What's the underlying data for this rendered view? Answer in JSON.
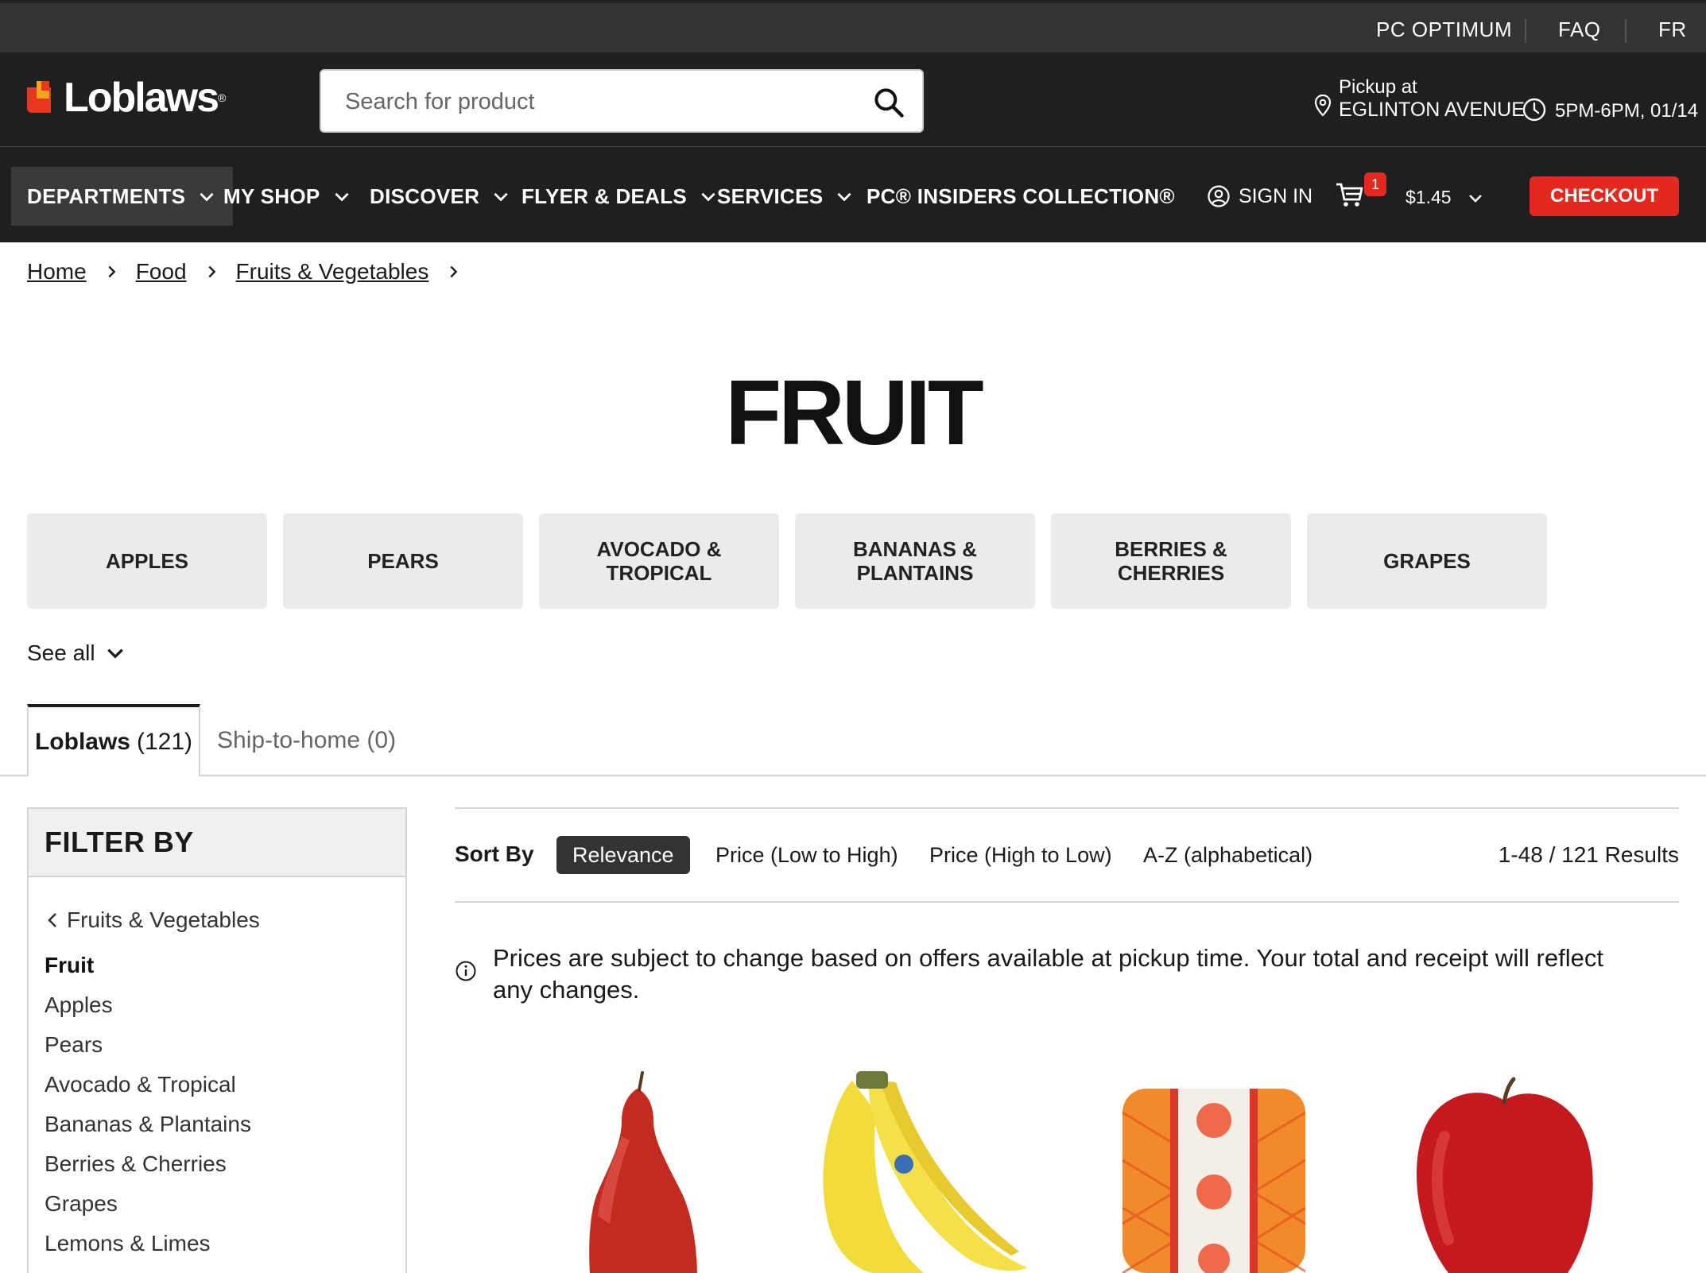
{
  "utility": {
    "pc_optimum": "PC OPTIMUM",
    "faq": "FAQ",
    "lang": "FR"
  },
  "header": {
    "logo_text": "Loblaws",
    "logo_reg": "®",
    "search_placeholder": "Search for product",
    "pickup_label": "Pickup at",
    "pickup_location": "EGLINTON AVENUE",
    "timeslot": "5PM-6PM, 01/14"
  },
  "nav": {
    "items": [
      {
        "label": "DEPARTMENTS"
      },
      {
        "label": "MY SHOP"
      },
      {
        "label": "DISCOVER"
      },
      {
        "label": "FLYER & DEALS"
      },
      {
        "label": "SERVICES"
      },
      {
        "label": "PC® INSIDERS COLLECTION®"
      }
    ],
    "sign_in": "SIGN IN",
    "cart_count": "1",
    "cart_total": "$1.45",
    "checkout": "CHECKOUT"
  },
  "breadcrumb": [
    "Home",
    "Food",
    "Fruits & Vegetables"
  ],
  "page_title": "FRUIT",
  "tiles": [
    "APPLES",
    "PEARS",
    "AVOCADO & TROPICAL",
    "BANANAS & PLANTAINS",
    "BERRIES & CHERRIES",
    "GRAPES"
  ],
  "see_all": "See all",
  "tabs": {
    "loblaws_label": "Loblaws",
    "loblaws_count": "(121)",
    "ship_label": "Ship-to-home (0)"
  },
  "filter": {
    "title": "FILTER BY",
    "back": "Fruits & Vegetables",
    "current": "Fruit",
    "items": [
      "Apples",
      "Pears",
      "Avocado & Tropical",
      "Bananas & Plantains",
      "Berries & Cherries",
      "Grapes",
      "Lemons & Limes"
    ]
  },
  "sort": {
    "label": "Sort By",
    "options": [
      "Relevance",
      "Price (Low to High)",
      "Price (High to Low)",
      "A-Z (alphabetical)"
    ],
    "results": "1-48 / 121 Results"
  },
  "notice": "Prices are subject to change based on offers available at pickup time. Your total and receipt will reflect any changes.",
  "products": [
    {
      "icon": "pear-image"
    },
    {
      "icon": "banana-image"
    },
    {
      "icon": "grapefruit-bag-image"
    },
    {
      "icon": "apple-image"
    }
  ],
  "colors": {
    "accent_red": "#e3281d",
    "header_bg": "#1f1f1f",
    "utility_bg": "#333333"
  }
}
